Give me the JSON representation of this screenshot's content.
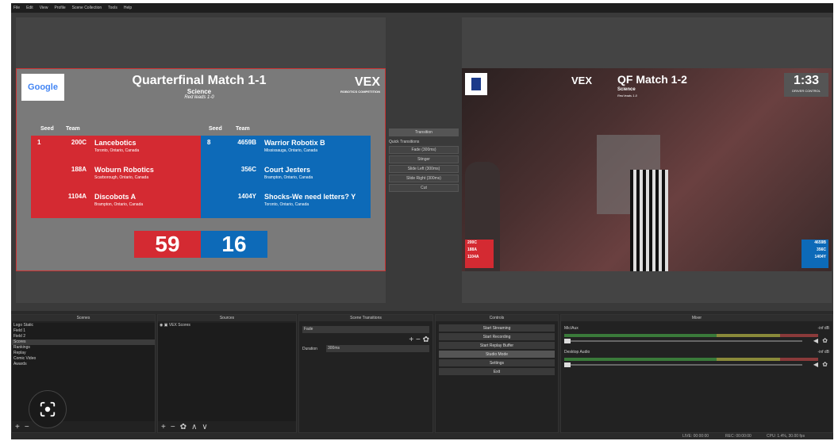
{
  "menu": [
    "File",
    "Edit",
    "View",
    "Profile",
    "Scene Collection",
    "Tools",
    "Help"
  ],
  "preview": {
    "google_logo": "Google",
    "title": "Quarterfinal Match 1-1",
    "subtitle": "Science",
    "note": "Red leads 1-0",
    "vex_logo": "VEX",
    "vex_sub": "ROBOTICS COMPETITION",
    "headers": {
      "seed": "Seed",
      "team": "Team"
    },
    "red": [
      {
        "seed": "1",
        "num": "200C",
        "name": "Lancebotics",
        "loc": "Toronto, Ontario, Canada"
      },
      {
        "seed": "",
        "num": "188A",
        "name": "Woburn Robotics",
        "loc": "Scarborough, Ontario, Canada"
      },
      {
        "seed": "",
        "num": "1104A",
        "name": "Discobots A",
        "loc": "Brampton, Ontario, Canada"
      }
    ],
    "blue": [
      {
        "seed": "8",
        "num": "4659B",
        "name": "Warrior Robotix B",
        "loc": "Mississauga, Ontario, Canada"
      },
      {
        "seed": "",
        "num": "356C",
        "name": "Court Jesters",
        "loc": "Brampton, Ontario, Canada"
      },
      {
        "seed": "",
        "num": "1404Y",
        "name": "Shocks-We need letters? Y",
        "loc": "Toronto, Ontario, Canada"
      }
    ],
    "red_score": "59",
    "blue_score": "16"
  },
  "transitions": {
    "button": "Transition",
    "quick_label": "Quick Transitions",
    "items": [
      "Fade (300ms)",
      "Stinger",
      "Slide Left (300ms)",
      "Slide Right (300ms)",
      "Cut"
    ]
  },
  "program": {
    "title": "QF Match 1-2",
    "subtitle": "Science",
    "note": "Red leads 1-0",
    "vex_logo": "VEX",
    "timer": "1:33",
    "timer_label": "DRIVER CONTROL",
    "red_teams": [
      "200C",
      "188A",
      "1104A"
    ],
    "blue_teams": [
      "4659B",
      "356C",
      "1404Y"
    ]
  },
  "docks": {
    "scenes": {
      "title": "Scenes",
      "items": [
        "Logo Static",
        "Field 1",
        "Field 2",
        "Scores",
        "Rankings",
        "Replay",
        "Comic Video",
        "Awards"
      ],
      "selected": 3
    },
    "sources": {
      "title": "Sources",
      "items": [
        "VEX Scores"
      ]
    },
    "scene_transitions": {
      "title": "Scene Transitions",
      "selected": "Fade",
      "duration_label": "Duration",
      "duration_value": "300ms"
    },
    "controls": {
      "title": "Controls",
      "buttons": [
        "Start Streaming",
        "Start Recording",
        "Start Replay Buffer",
        "Studio Mode",
        "Settings",
        "Exit"
      ],
      "active": 3
    },
    "mixer": {
      "title": "Mixer",
      "channels": [
        {
          "name": "Mic/Aux",
          "db": "-inf dB"
        },
        {
          "name": "Desktop Audio",
          "db": "-inf dB"
        }
      ]
    }
  },
  "status": {
    "live": "LIVE: 00:00:00",
    "rec": "REC: 00:00:00",
    "cpu": "CPU: 1.4%, 30.00 fps"
  },
  "overlay_icon": "lens-icon"
}
